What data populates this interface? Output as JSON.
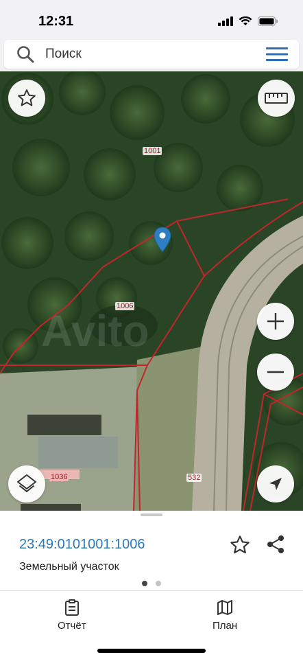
{
  "status_bar": {
    "time": "12:31"
  },
  "search": {
    "placeholder": "Поиск"
  },
  "map": {
    "labels": {
      "parcel_1001": "1001",
      "parcel_1006": "1006",
      "parcel_1036": "1036",
      "parcel_532": "532"
    },
    "watermark": "Avito"
  },
  "sheet": {
    "cadastral_number": "23:49:0101001:1006",
    "parcel_type": "Земельный участок",
    "page_count": 2,
    "active_page": 1
  },
  "nav": {
    "report_label": "Отчёт",
    "plan_label": "План"
  },
  "colors": {
    "accent": "#2a7ab8",
    "menu": "#2d6db3",
    "boundary": "#c0262b",
    "marker": "#2e7fc1"
  },
  "icons": [
    "search-icon",
    "menu-icon",
    "star-icon",
    "ruler-icon",
    "layers-icon",
    "location-pin-icon",
    "zoom-in-icon",
    "zoom-out-icon",
    "navigation-arrow-icon",
    "share-icon",
    "clipboard-icon",
    "map-icon"
  ]
}
